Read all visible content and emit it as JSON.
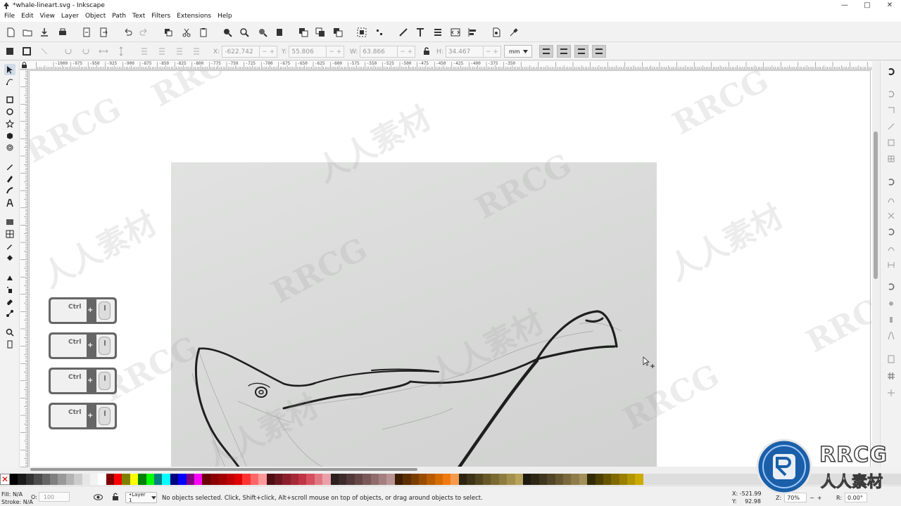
{
  "window": {
    "title": "*whale-lineart.svg - Inkscape",
    "controls": [
      "—",
      "□",
      "✕"
    ]
  },
  "menu": [
    "File",
    "Edit",
    "View",
    "Layer",
    "Object",
    "Path",
    "Text",
    "Filters",
    "Extensions",
    "Help"
  ],
  "toolbar": {
    "x_label": "X:",
    "x_value": "-622.742",
    "y_label": "Y:",
    "y_value": "55.806",
    "w_label": "W:",
    "w_value": "63.866",
    "h_label": "H:",
    "h_value": "34.467",
    "spin": "− +",
    "unit": "mm"
  },
  "ruler": {
    "labels": [
      "-1000",
      "-975",
      "-950",
      "-925",
      "-900",
      "-875",
      "-850",
      "-825",
      "-800",
      "-775",
      "-750",
      "-725",
      "-700",
      "-675",
      "-650",
      "-625",
      "-600",
      "-575",
      "-550",
      "-525",
      "-500",
      "-475",
      "-450",
      "-425",
      "-400",
      "-375",
      "-350"
    ]
  },
  "keyboard_hints": [
    {
      "key": "Ctrl",
      "plus": "+"
    },
    {
      "key": "Ctrl",
      "plus": "+"
    },
    {
      "key": "Ctrl",
      "plus": "+"
    },
    {
      "key": "Ctrl",
      "plus": "+"
    }
  ],
  "watermarks": [
    "RRCG",
    "人人素材"
  ],
  "palette": {
    "none_symbol": "✕",
    "colors": [
      "#000000",
      "#1a1a1a",
      "#333333",
      "#4d4d4d",
      "#666666",
      "#808080",
      "#999999",
      "#b3b3b3",
      "#cccccc",
      "#e6e6e6",
      "#f2f2f2",
      "#ffffff",
      "#800000",
      "#ff0000",
      "#808000",
      "#ffff00",
      "#008000",
      "#00ff00",
      "#008080",
      "#00ffff",
      "#000080",
      "#0000ff",
      "#800080",
      "#ff00ff",
      "#6b0000",
      "#8b0000",
      "#a00000",
      "#c00000",
      "#e00000",
      "#ff3333",
      "#ff6666",
      "#ff9999",
      "#4d0f14",
      "#6b1620",
      "#8a1f2b",
      "#a52a36",
      "#c03545",
      "#d5505e",
      "#e07883",
      "#eba0a8",
      "#2b1f1f",
      "#3d2a2a",
      "#523838",
      "#664747",
      "#7a5858",
      "#8f6b6b",
      "#a37f7f",
      "#b89494",
      "#3d1f00",
      "#5c2e00",
      "#7a3d00",
      "#994d00",
      "#b85c00",
      "#d66b00",
      "#f07a10",
      "#f59a4a",
      "#2b2410",
      "#3d3418",
      "#524620",
      "#665829",
      "#7a6a33",
      "#8f7d3f",
      "#a3904d",
      "#b8a35e",
      "#1f1a0f",
      "#2e2716",
      "#40361f",
      "#524628",
      "#665732",
      "#7a693d",
      "#8f7c4a",
      "#a39058",
      "#332b00",
      "#4d4000",
      "#665500",
      "#806a00",
      "#998000",
      "#b39500",
      "#ccaa00"
    ]
  },
  "status": {
    "fill_label": "Fill:",
    "fill_value": "N/A",
    "stroke_label": "Stroke:",
    "stroke_value": "N/A",
    "opacity_label": "O:",
    "opacity_value": "100",
    "layer": "•Layer 1",
    "message": "No objects selected. Click, Shift+click, Alt+scroll mouse on top of objects, or drag around objects to select.",
    "x_label": "X:",
    "x_value": "-521.99",
    "y_label": "Y:",
    "y_value": "92.98",
    "zoom_label": "Z:",
    "zoom_value": "70%",
    "rotate_label": "R:",
    "rotate_value": "0.00°",
    "minus": "−",
    "plus": "+"
  },
  "badge": {
    "logo": "RRCG",
    "sub": "人人素材"
  }
}
